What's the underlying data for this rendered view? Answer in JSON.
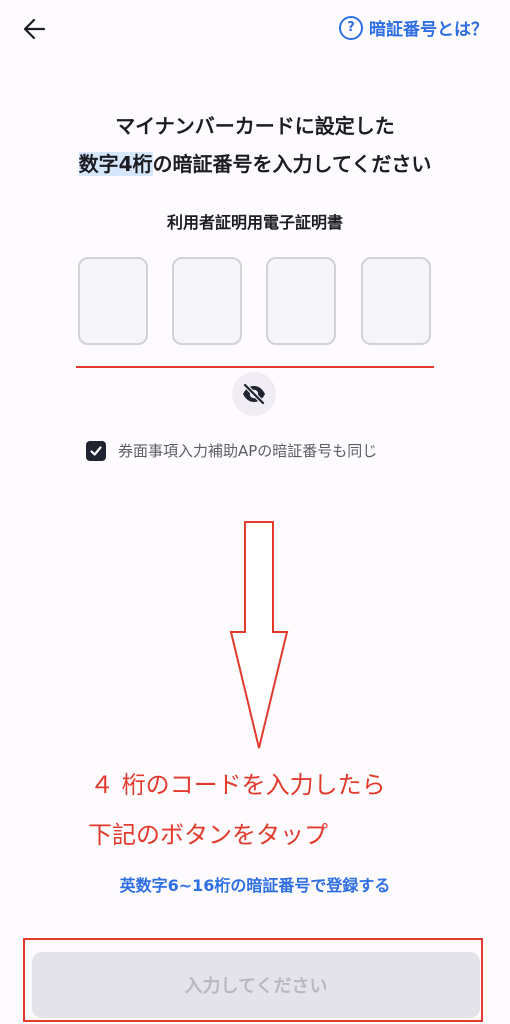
{
  "header": {
    "help_label": "暗証番号とは？"
  },
  "main": {
    "title_line1": "マイナンバーカードに設定した",
    "title_line2_highlight": "数字4桁",
    "title_line2_rest": "の暗証番号を入力してください",
    "subtitle": "利用者証明用電子証明書",
    "pin_values": [
      "",
      "",
      "",
      ""
    ],
    "checkbox": {
      "checked": true,
      "label": "券面事項入力補助APの暗証番号も同じ"
    },
    "alt_link": "英数字6~16桁の暗証番号で登録する",
    "submit_label": "入力してください"
  },
  "annotation": {
    "line1": "４ 桁のコードを入力したら",
    "line2": "下記のボタンをタップ",
    "color": "#e23b2e"
  },
  "colors": {
    "accent": "#2f6fe4",
    "annotation_red": "#e23b2e",
    "checkbox": "#1f2430"
  }
}
